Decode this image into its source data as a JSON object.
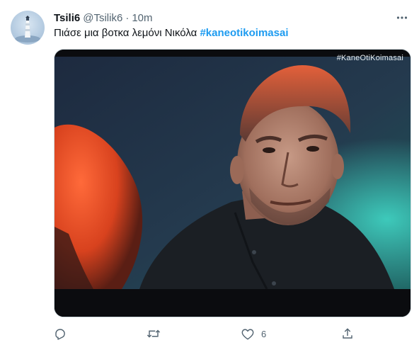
{
  "tweet": {
    "author": {
      "display_name": "Tsili6",
      "handle": "@Tsilik6",
      "avatar_icon": "lighthouse-avatar"
    },
    "separator": "·",
    "time": "10m",
    "text": "Πιάσε μια βοτκα λεμόνι Νικόλα",
    "hashtag": "#kaneotikoimasai",
    "media": {
      "overlay_tag": "#KaneOtiKoimasai"
    },
    "actions": {
      "reply_icon": "reply-icon",
      "retweet_icon": "retweet-icon",
      "like_icon": "heart-icon",
      "like_count": "6",
      "share_icon": "share-icon"
    },
    "more_icon": "more-dots-icon"
  },
  "colors": {
    "accent": "#1d9bf0",
    "secondary_text": "#536471",
    "primary_text": "#0f1419"
  }
}
